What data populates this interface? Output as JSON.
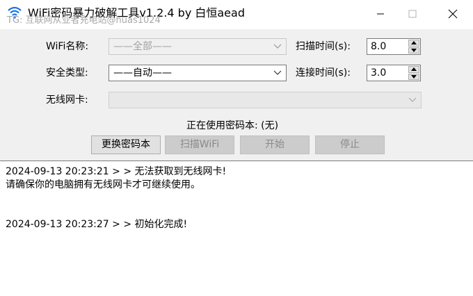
{
  "window": {
    "title": "WiFi密码暴力破解工具v1.2.4 by 白恒aead",
    "watermark": "TG: 互联网从业者充电站@huas1024"
  },
  "form": {
    "wifi_name": {
      "label": "WiFi名称:",
      "value": "——全部——"
    },
    "security_type": {
      "label": "安全类型:",
      "value": "——自动——"
    },
    "wireless_card": {
      "label": "无线网卡:",
      "value": ""
    },
    "scan_time": {
      "label": "扫描时间(s):",
      "value": "8.0"
    },
    "connect_time": {
      "label": "连接时间(s):",
      "value": "3.0"
    }
  },
  "status": {
    "text": "正在使用密码本: (无)"
  },
  "buttons": {
    "change_dict": "更换密码本",
    "scan_wifi": "扫描WiFi",
    "start": "开始",
    "stop": "停止"
  },
  "log": {
    "lines": [
      "2024-09-13 20:23:21 > > 无法获取到无线网卡!",
      "请确保你的电脑拥有无线网卡才可继续使用。",
      "",
      "",
      "2024-09-13 20:23:27 > > 初始化完成!"
    ]
  },
  "icons": {
    "app": "wifi-icon",
    "minimize": "minimize-icon",
    "maximize": "maximize-icon",
    "close": "close-icon",
    "dropdown": "chevron-down-icon",
    "spin_up": "spin-up-icon",
    "spin_down": "spin-down-icon"
  },
  "colors": {
    "accent": "#1a73e8",
    "disabled_text": "#8a8a8a",
    "window_bg": "#f0f0f0"
  }
}
